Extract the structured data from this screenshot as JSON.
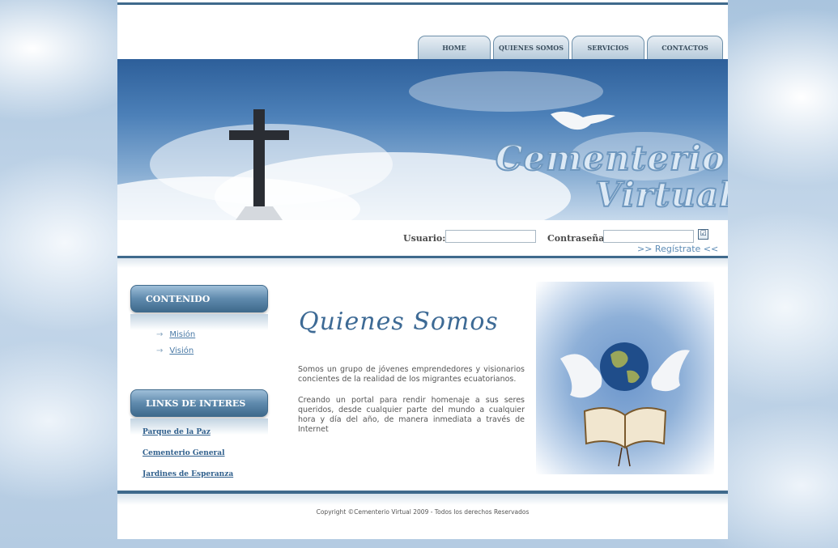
{
  "nav": {
    "items": [
      "HOME",
      "QUIENES SOMOS",
      "SERVICIOS",
      "CONTACTOS"
    ]
  },
  "banner": {
    "logo_line1": "Cementerio",
    "logo_line2": "Virtual"
  },
  "login": {
    "user_label": "Usuario:",
    "user_value": "",
    "password_label": "Contraseña:",
    "password_value": "",
    "checkbox_mark": "☑",
    "register_link": ">> Regístrate <<"
  },
  "sidebar": {
    "content_title": "CONTENIDO",
    "content_links": [
      {
        "arrow": "→",
        "label": "Misión"
      },
      {
        "arrow": "→",
        "label": "Visión"
      }
    ],
    "links_title": "LINKS DE INTERES",
    "links": [
      "Parque de la Paz",
      "Cementerio General",
      "Jardines de Esperanza"
    ]
  },
  "main": {
    "title": "Quienes Somos",
    "paragraph1": "Somos un grupo de jóvenes emprendedores y visionarios concientes de la realidad de los migrantes ecuatorianos.",
    "paragraph2": "Creando un portal para rendir homenaje a sus seres queridos, desde cualquier parte del mundo a cualquier hora y día del año, de manera inmediata a través de Internet"
  },
  "footer": {
    "copyright": "Copyright ©Cementerio Virtual 2009 - Todos los derechos Reservados"
  }
}
